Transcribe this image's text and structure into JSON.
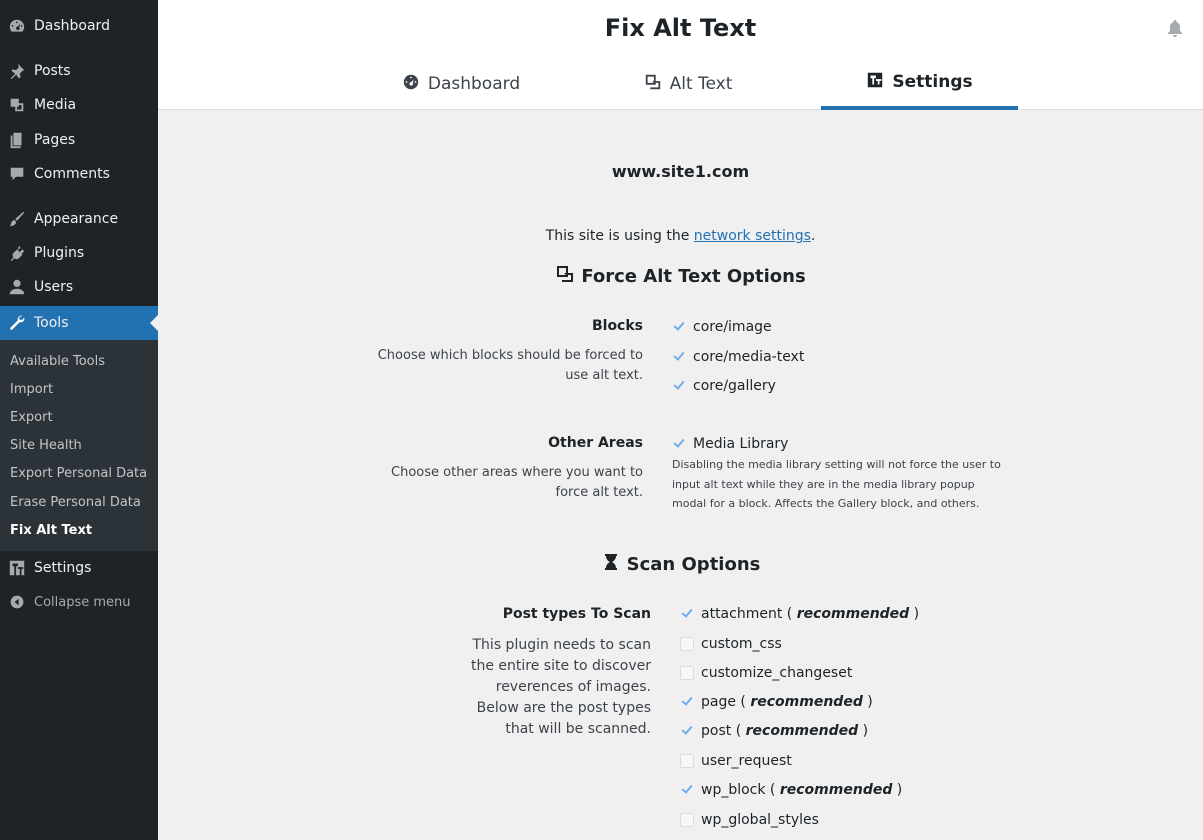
{
  "sidebar": {
    "items": [
      {
        "label": "Dashboard",
        "icon": "dashboard-icon"
      },
      {
        "label": "Posts",
        "icon": "pushpin-icon"
      },
      {
        "label": "Media",
        "icon": "media-icon"
      },
      {
        "label": "Pages",
        "icon": "pages-icon"
      },
      {
        "label": "Comments",
        "icon": "comment-icon"
      },
      {
        "label": "Appearance",
        "icon": "brush-icon"
      },
      {
        "label": "Plugins",
        "icon": "plugin-icon"
      },
      {
        "label": "Users",
        "icon": "user-icon"
      },
      {
        "label": "Tools",
        "icon": "wrench-icon"
      },
      {
        "label": "Settings",
        "icon": "settings-icon"
      }
    ],
    "submenu": [
      "Available Tools",
      "Import",
      "Export",
      "Site Health",
      "Export Personal Data",
      "Erase Personal Data",
      "Fix Alt Text"
    ],
    "collapse_label": "Collapse menu"
  },
  "header": {
    "title": "Fix Alt Text",
    "tabs": [
      {
        "label": "Dashboard",
        "icon": "gauge-icon"
      },
      {
        "label": "Alt Text",
        "icon": "images-icon"
      },
      {
        "label": "Settings",
        "icon": "sliders-icon"
      }
    ]
  },
  "main": {
    "site_name": "www.site1.com",
    "network_note_prefix": "This site is using the ",
    "network_note_link": "network settings",
    "network_note_suffix": ".",
    "force_heading": "Force Alt Text Options",
    "blocks": {
      "label": "Blocks",
      "desc": "Choose which blocks should be forced to use alt text.",
      "options": [
        "core/image",
        "core/media-text",
        "core/gallery"
      ]
    },
    "other_areas": {
      "label": "Other Areas",
      "desc": "Choose other areas where you want to force alt text.",
      "option": "Media Library",
      "note": "Disabling the media library setting will not force the user to input alt text while they are in the media library popup modal for a block. Affects the Gallery block, and others."
    },
    "scan_heading": "Scan Options",
    "post_types": {
      "label": "Post types To Scan",
      "desc": "This plugin needs to scan the entire site to discover reverences of images. Below are the post types that will be scanned.",
      "recommended_word": "recommended",
      "options": [
        {
          "name": "attachment",
          "checked": true,
          "recommended": true
        },
        {
          "name": "custom_css",
          "checked": false,
          "recommended": false
        },
        {
          "name": "customize_changeset",
          "checked": false,
          "recommended": false
        },
        {
          "name": "page",
          "checked": true,
          "recommended": true
        },
        {
          "name": "post",
          "checked": true,
          "recommended": true
        },
        {
          "name": "user_request",
          "checked": false,
          "recommended": false
        },
        {
          "name": "wp_block",
          "checked": true,
          "recommended": true
        },
        {
          "name": "wp_global_styles",
          "checked": false,
          "recommended": false
        }
      ]
    }
  },
  "colors": {
    "accent": "#2271b1",
    "sidebar_bg": "#1d2327",
    "submenu_bg": "#2c3338",
    "check": "#72aee6"
  }
}
